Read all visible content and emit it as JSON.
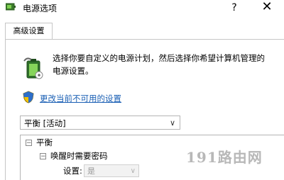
{
  "window": {
    "title": "电源选项",
    "help_label": "?",
    "close_label": "✕"
  },
  "tabs": [
    {
      "label": "高级设置"
    }
  ],
  "description": "选择你要自定义的电源计划，然后选择你希望计算机管理的电源设置。",
  "change_link": "更改当前不可用的设置",
  "plan_select": {
    "value": "平衡 [活动]"
  },
  "tree": {
    "root": "平衡",
    "child": "唤醒时需要密码",
    "setting_label": "设置:",
    "setting_value": "是"
  },
  "watermark": "191路由网",
  "colors": {
    "link": "#1a5fb4",
    "border": "#c6c6c6"
  },
  "icons": [
    "power-plan-icon",
    "shield-icon",
    "chevron-down-icon",
    "collapse-icon"
  ]
}
